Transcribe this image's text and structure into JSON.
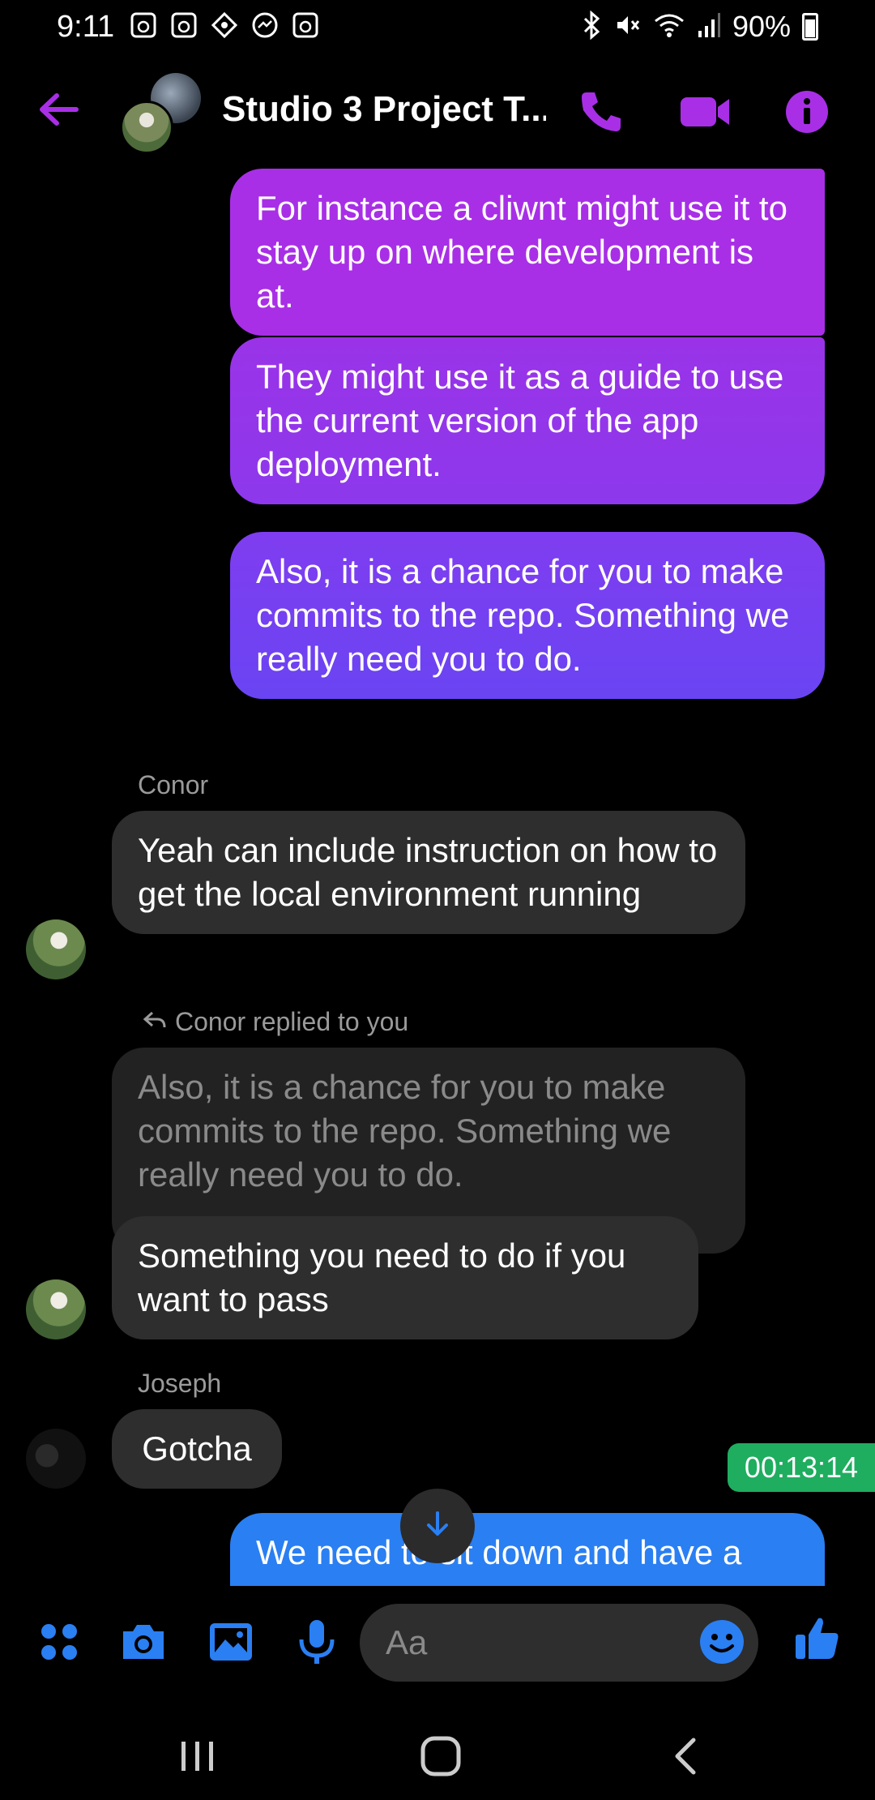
{
  "status_bar": {
    "time": "9:11",
    "battery": "90%"
  },
  "header": {
    "title": "Studio 3 Project T..."
  },
  "messages": {
    "mine_1": "For instance a cliwnt might use it to stay up on where development is at.",
    "mine_2": "They might use it as a guide to use the current version of the app deployment.",
    "mine_3": "Also, it is a chance for you to make commits to the repo. Something we really need you to do.",
    "conor_name": "Conor",
    "conor_1": "Yeah can include instruction on how to get the local environment running",
    "reply_label": "Conor replied to you",
    "quoted": "Also, it is a chance for you to make commits to the repo. Something we really need you to do.",
    "conor_2": "Something you need to do if you want to pass",
    "joseph_name": "Joseph",
    "joseph_1": "Gotcha",
    "mine_4": "We need to sit down and have a"
  },
  "timer": "00:13:14",
  "composer": {
    "placeholder": "Aa"
  },
  "colors": {
    "accent_purple": "#a82fe6",
    "accent_blue": "#2a7ff2",
    "timer_green": "#1fad5f",
    "bubble_gray": "#2e2e2e"
  }
}
